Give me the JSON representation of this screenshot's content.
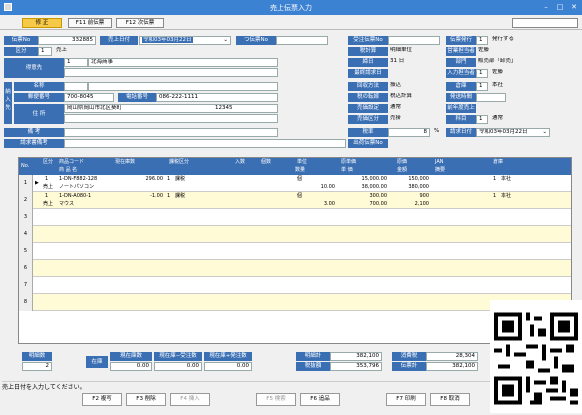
{
  "window": {
    "title": "売上伝票入力",
    "min": "–",
    "max": "□",
    "close": "✕"
  },
  "toolbar": {
    "mode": "修 正",
    "f11": "F11 前伝票",
    "f12": "F12 次伝票"
  },
  "header": {
    "denpyo_label": "伝票No",
    "denpyo_val": "332885",
    "uriagebi_label": "売上日付",
    "uriagebi_val": "令和03年03月22日",
    "tsuden_label": "つ伝票No",
    "kubun_label": "区分",
    "kubun_code": "1",
    "kubun_name": "売上",
    "tokui_label": "得意先",
    "tokui_code": "1",
    "tokui_name": "北海商事",
    "nohin_label": "納入先",
    "name_label": "名称",
    "zip_label": "郵便番号",
    "zip_val": "700-8045",
    "tel_label": "電話番号",
    "tel_val": "086-222-1111",
    "addr_label": "住 所",
    "addr_val": "岡山県岡山市北区葵町",
    "addr_val2": "12345",
    "biko_label": "備 考",
    "seikyu_label": "請求書備考",
    "juchu_label": "受注伝票No",
    "zei_label": "税計算",
    "zei_val": "明細単位",
    "shime_label": "締日",
    "shime_val": "31 日",
    "saishu_label": "最終請求日",
    "kaishu_label": "回収方法",
    "kaishu_val": "振込",
    "zeitenka_label": "税の転嫁",
    "zeitenka_val": "税込計算",
    "hasu_label": "売価設定",
    "hasu_val": "通常",
    "torihiki_label": "売価区分",
    "torihiki_val": "売掛",
    "zeiritsu_label": "税率",
    "zeiritsu_val": "8",
    "zeiritsu_unit": "%",
    "shukka_label": "出荷伝票No",
    "hakko_label": "伝票発行",
    "hakko_code": "1",
    "hakko_val": "発行する",
    "eigyo_label": "営業担当者",
    "eigyo_val": "佐藤",
    "bumon_label": "部門",
    "bumon_val": "販売部「卸売」",
    "nyuryoku_label": "入力担当者",
    "nyuryoku_code": "1",
    "nyuryoku_val": "佐藤",
    "soko_label": "倉庫",
    "soko_code": "1",
    "soko_val": "本社",
    "hasso_label": "発送時間",
    "kaishubi_label": "前年度売上",
    "kamoku_label": "科目",
    "kamoku_code": "1",
    "kamoku_val": "通常",
    "seikyubi_label": "請求日付",
    "seikyubi_val": "令和03年03月22日"
  },
  "grid": {
    "h": {
      "no": "No.",
      "kubun": "区分",
      "code": "商品コード",
      "name": "商 品 名",
      "zaiko": "現在庫数",
      "kazei": "課税区分",
      "iri": "入数",
      "ko": "個数",
      "tani": "単位",
      "suryo": "数量",
      "genka_t": "原単価",
      "tanka": "単 価",
      "genka": "原価",
      "kingaku": "金額",
      "jan": "JAN",
      "tekiyo": "摘要",
      "soko": "倉庫"
    },
    "rows": [
      {
        "no": "1",
        "mark": "▶",
        "kubun_c": "1",
        "kubun": "売上",
        "code": "1-DN-F882-128",
        "name": "ノートパソコン",
        "zaiko": "296.00",
        "kazei_c": "1",
        "kazei": "課税",
        "tani": "個",
        "suryo": "10.00",
        "genka_t": "15,000.00",
        "tanka": "38,000.00",
        "genka": "150,000",
        "kingaku": "380,000",
        "soko_c": "1",
        "soko": "本社"
      },
      {
        "no": "2",
        "mark": "",
        "kubun_c": "1",
        "kubun": "売上",
        "code": "1-DN-A080-1",
        "name": "マウス",
        "zaiko": "-1.00",
        "kazei_c": "1",
        "kazei": "課税",
        "tani": "個",
        "suryo": "3.00",
        "genka_t": "300.00",
        "tanka": "700.00",
        "genka": "900",
        "kingaku": "2,100",
        "soko_c": "1",
        "soko": "本社"
      },
      {
        "no": "3"
      },
      {
        "no": "4"
      },
      {
        "no": "5"
      },
      {
        "no": "6"
      },
      {
        "no": "7"
      },
      {
        "no": "8"
      }
    ]
  },
  "footer": {
    "meisai_label": "明細数",
    "meisai_val": "2",
    "zaiko_label": "在庫",
    "genzaiko_label": "現在庫数",
    "genzaiko_val": "0.00",
    "juchu_label": "現在庫−受注数",
    "juchu_val": "0.00",
    "hacchu_label": "現在庫+発注数",
    "hacchu_val": "0.00",
    "genka_label": "明細計",
    "genka_val": "382,100",
    "zeinuki_label": "税抜額",
    "zeinuki_val": "353,796",
    "shohizei_label": "消費税",
    "shohizei_val": "28,304",
    "total_label": "伝票計",
    "total_val": "382,100"
  },
  "status": "売上日付を入力してください。",
  "buttons": {
    "f2": "F2 複写",
    "f3": "F3 削除",
    "f4": "F4 挿入",
    "f5": "F5 検索",
    "f6": "F6 追品",
    "f7": "F7 印刷",
    "f8": "F8 取消"
  }
}
